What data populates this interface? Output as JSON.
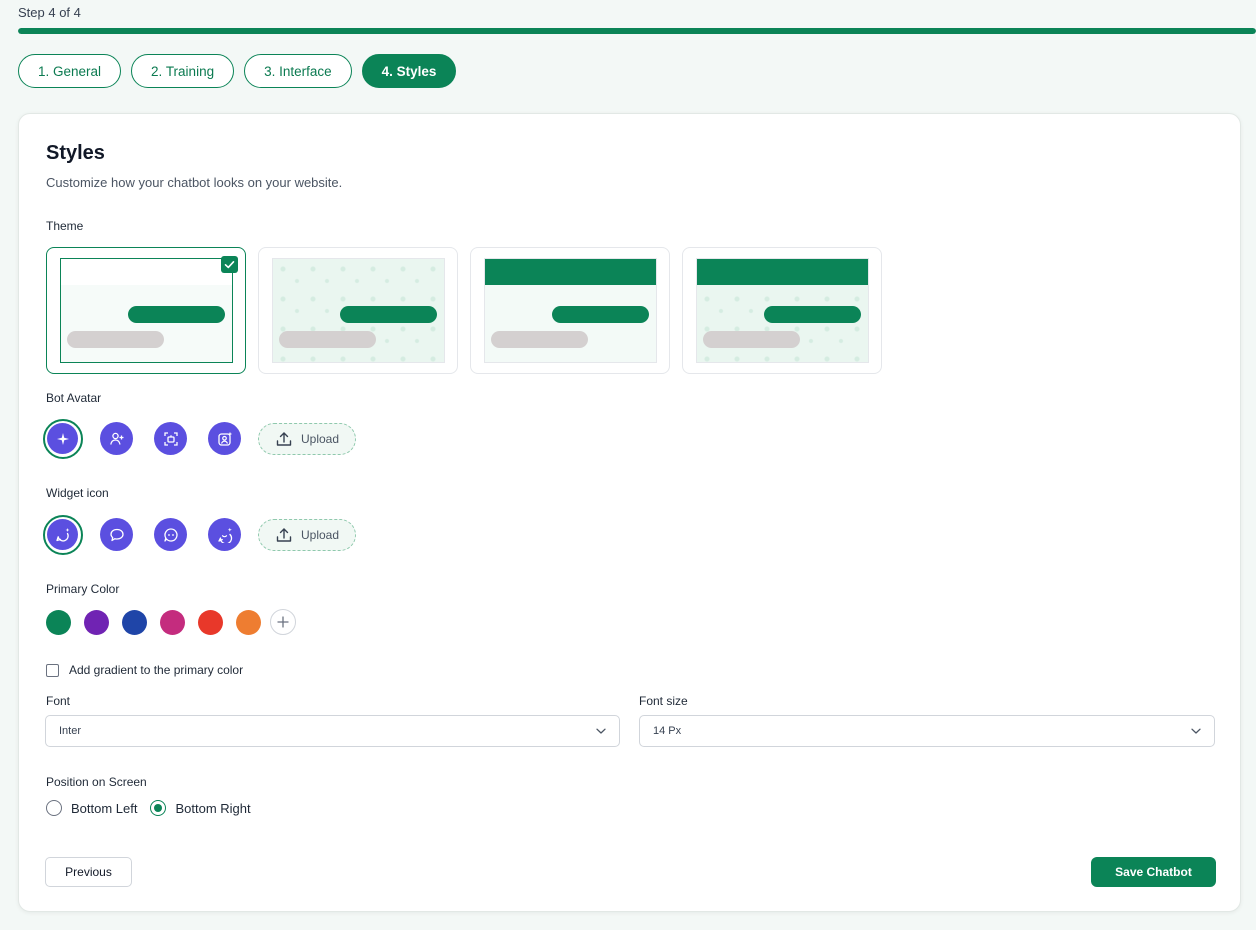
{
  "step_label": "Step 4 of 4",
  "progress": 1.0,
  "accent_color": "#0b8457",
  "tabs": [
    {
      "label": "1. General",
      "active": false
    },
    {
      "label": "2. Training",
      "active": false
    },
    {
      "label": "3. Interface",
      "active": false
    },
    {
      "label": "4. Styles",
      "active": true
    }
  ],
  "page": {
    "title": "Styles",
    "subtitle": "Customize how your chatbot looks on your website."
  },
  "theme": {
    "label": "Theme",
    "options": [
      {
        "style": "plain",
        "selected": true
      },
      {
        "style": "pattern",
        "selected": false
      },
      {
        "style": "header",
        "selected": false
      },
      {
        "style": "header-pattern",
        "selected": false
      }
    ]
  },
  "bot_avatar": {
    "label": "Bot Avatar",
    "icons": [
      "sparkles-icon",
      "user-plus-icon",
      "bot-scan-icon",
      "user-sparkle-icon"
    ],
    "selected_index": 0,
    "upload_label": "Upload"
  },
  "widget_icon": {
    "label": "Widget icon",
    "icons": [
      "chat-sparkle-icon",
      "chat-bubble-icon",
      "chat-dots-icon",
      "chat-smile-icon"
    ],
    "selected_index": 0,
    "upload_label": "Upload"
  },
  "primary_color": {
    "label": "Primary Color",
    "swatches": [
      "#0b8457",
      "#7023b3",
      "#1f45a8",
      "#c42c7e",
      "#e8382a",
      "#ee7d31"
    ]
  },
  "gradient": {
    "label": "Add gradient to the primary color",
    "checked": false
  },
  "font": {
    "label": "Font",
    "value": "Inter"
  },
  "font_size": {
    "label": "Font size",
    "value": "14 Px"
  },
  "position": {
    "label": "Position on Screen",
    "options": [
      {
        "label": "Bottom Left",
        "selected": false
      },
      {
        "label": "Bottom Right",
        "selected": true
      }
    ]
  },
  "buttons": {
    "previous": "Previous",
    "save": "Save Chatbot"
  }
}
